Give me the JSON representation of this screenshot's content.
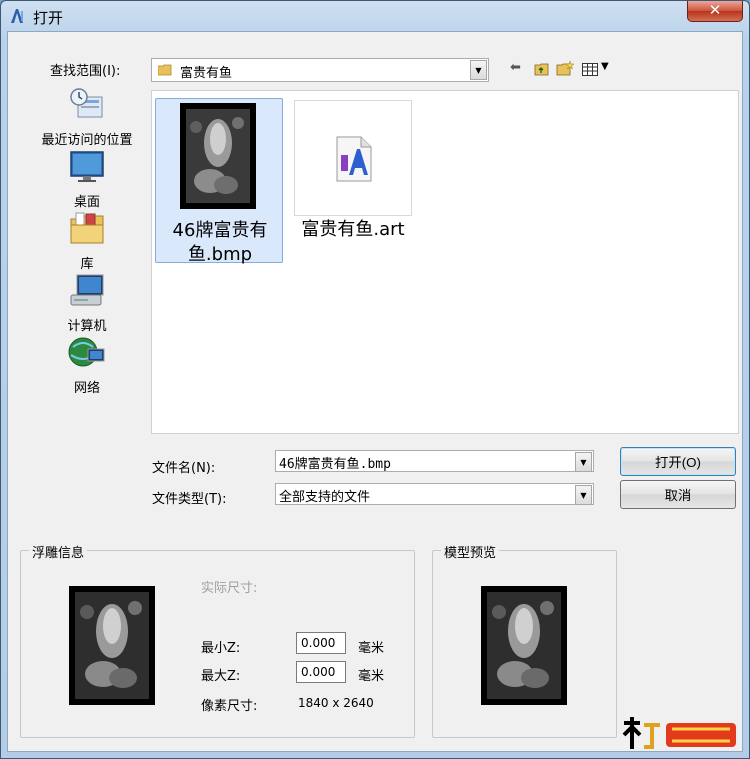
{
  "window": {
    "title": "打开",
    "close_glyph": "✕"
  },
  "lookin": {
    "label": "查找范围(I):",
    "value": "富贵有鱼"
  },
  "places": [
    {
      "label": "最近访问的位置",
      "icon": "recent-places-icon"
    },
    {
      "label": "桌面",
      "icon": "desktop-icon"
    },
    {
      "label": "库",
      "icon": "library-icon"
    },
    {
      "label": "计算机",
      "icon": "computer-icon"
    },
    {
      "label": "网络",
      "icon": "network-icon"
    }
  ],
  "files": [
    {
      "name": "46牌富贵有鱼.bmp",
      "selected": true
    },
    {
      "name": "富贵有鱼.art",
      "selected": false
    }
  ],
  "filename": {
    "label": "文件名(N):",
    "value": "46牌富贵有鱼.bmp"
  },
  "filetype": {
    "label": "文件类型(T):",
    "value": "全部支持的文件"
  },
  "buttons": {
    "open": "打开(O)",
    "cancel": "取消"
  },
  "relief_info": {
    "title": "浮雕信息",
    "actual_size_label": "实际尺寸:",
    "min_z_label": "最小Z:",
    "min_z_value": "0.000",
    "max_z_label": "最大Z:",
    "max_z_value": "0.000",
    "unit": "毫米",
    "pixel_size_label": "像素尺寸:",
    "pixel_size_value": "1840 x 2640"
  },
  "model_preview": {
    "title": "模型预览"
  },
  "colors": {
    "selection_bg": "#d9e8fb",
    "close_red": "#c8412a",
    "title_blue": "#b9d1ea"
  }
}
